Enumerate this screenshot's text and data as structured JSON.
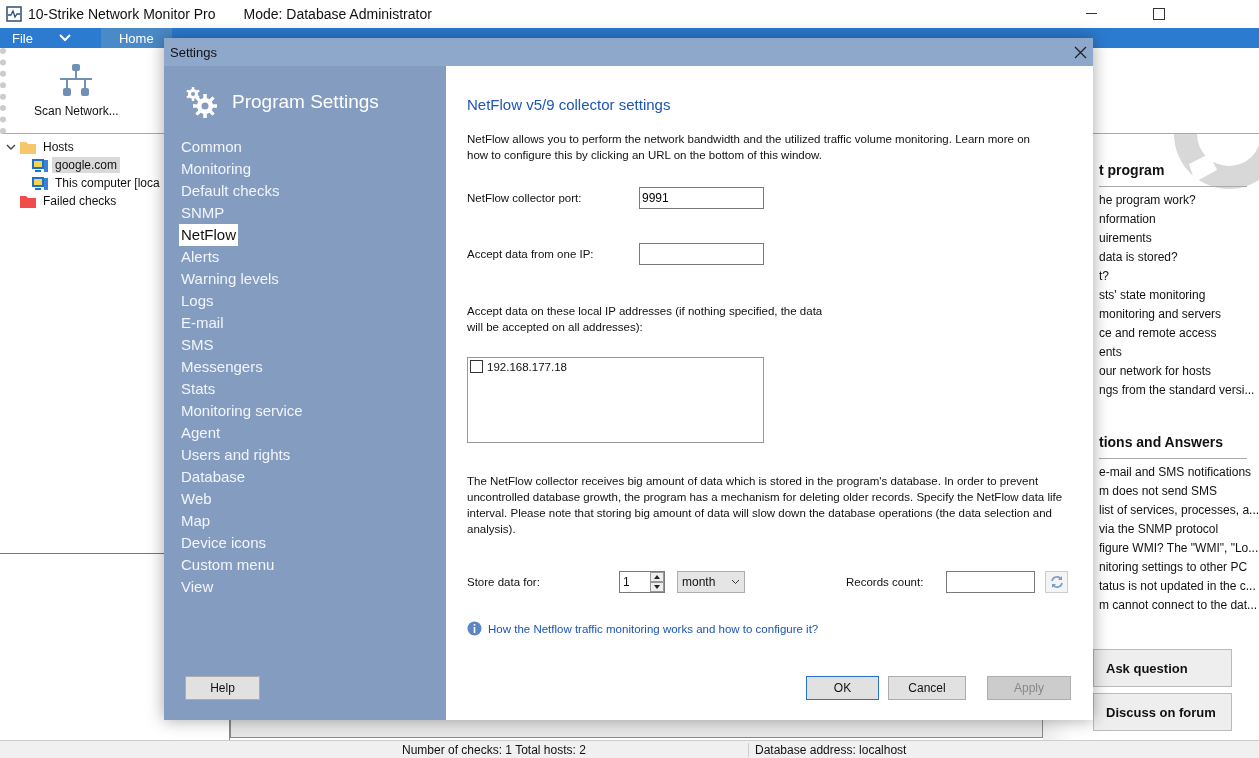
{
  "window": {
    "title": "10-Strike Network Monitor Pro",
    "mode": "Mode: Database Administrator"
  },
  "menu": [
    {
      "label": "File",
      "selected": false
    },
    {
      "label": "Home",
      "selected": true
    }
  ],
  "ribbon": {
    "buttons": [
      "Scan Network..."
    ]
  },
  "tree": [
    {
      "label": "Hosts",
      "kind": "folder",
      "color": "#f5c66a",
      "expanded": true,
      "selected": false,
      "children": [
        {
          "label": "google.com",
          "kind": "host",
          "selected": true
        },
        {
          "label": "This computer [loca",
          "kind": "host",
          "selected": false
        }
      ]
    },
    {
      "label": "Failed checks",
      "kind": "folder",
      "color": "#f24b4b",
      "selected": false
    }
  ],
  "help_panel": {
    "sections": [
      {
        "title": "t program",
        "links": [
          "he program work?",
          "nformation",
          "uirements",
          "data is stored?",
          "t?",
          "sts' state monitoring",
          "monitoring and servers",
          "ce and remote access",
          "ents",
          "our network for hosts",
          "ngs from the standard versi..."
        ]
      },
      {
        "title": "tions and Answers",
        "links": [
          "e-mail and SMS notifications",
          "m does not send SMS",
          "list of services, processes, a...",
          "via the SNMP protocol",
          "figure WMI? The \"WMI\", \"Lo...",
          "nitoring settings to other PC",
          "tatus is not updated in the c...",
          "m cannot connect to the dat..."
        ]
      }
    ],
    "buttons": [
      "Ask question",
      "Discuss on forum"
    ]
  },
  "status_bar": [
    "Number of checks: 1  Total hosts: 2",
    "Database address: localhost"
  ],
  "dialog": {
    "title": "Settings",
    "header": "Program Settings",
    "nav": [
      {
        "label": "Common",
        "selected": false
      },
      {
        "label": "Monitoring",
        "selected": false
      },
      {
        "label": "Default checks",
        "selected": false
      },
      {
        "label": "SNMP",
        "selected": false
      },
      {
        "label": "NetFlow",
        "selected": true
      },
      {
        "label": "Alerts",
        "selected": false
      },
      {
        "label": "Warning levels",
        "selected": false
      },
      {
        "label": "Logs",
        "selected": false
      },
      {
        "label": "E-mail",
        "selected": false
      },
      {
        "label": "SMS",
        "selected": false
      },
      {
        "label": "Messengers",
        "selected": false
      },
      {
        "label": "Stats",
        "selected": false
      },
      {
        "label": "Monitoring service",
        "selected": false
      },
      {
        "label": "Agent",
        "selected": false
      },
      {
        "label": "Users and rights",
        "selected": false
      },
      {
        "label": "Database",
        "selected": false
      },
      {
        "label": "Web",
        "selected": false
      },
      {
        "label": "Map",
        "selected": false
      },
      {
        "label": "Device icons",
        "selected": false
      },
      {
        "label": "Custom menu",
        "selected": false
      },
      {
        "label": "View",
        "selected": false
      }
    ],
    "help_button": "Help",
    "heading": "NetFlow v5/9 collector settings",
    "intro": "NetFlow allows you to perform the network bandwidth and the utilized traffic volume monitoring. Learn more on how to configure this by clicking an URL on the bottom of this window.",
    "port": {
      "label": "NetFlow collector port:",
      "value": "9991"
    },
    "one_ip": {
      "label": "Accept data from one IP:"
    },
    "local_ips": {
      "label": "Accept data on these local IP addresses (if nothing specified, the data will be accepted on all addresses):",
      "items": [
        {
          "label": "192.168.177.18",
          "checked": false
        }
      ]
    },
    "note": "The NetFlow collector receives big amount of data which is stored in the program's database. In order to prevent uncontrolled database growth, the program has a mechanism for deleting older records. Specify the NetFlow data life interval. Please note that storing big amount of data will slow down the database operations (the data selection and analysis).",
    "store": {
      "label": "Store data for:",
      "value": "1",
      "unit": "month"
    },
    "records": {
      "label": "Records count:"
    },
    "link": "How the Netflow traffic monitoring works and how to configure it?",
    "actions": [
      {
        "label": "OK",
        "focused": true,
        "disabled": false
      },
      {
        "label": "Cancel",
        "focused": false,
        "disabled": false
      },
      {
        "label": "Apply",
        "focused": false,
        "disabled": true
      }
    ]
  }
}
